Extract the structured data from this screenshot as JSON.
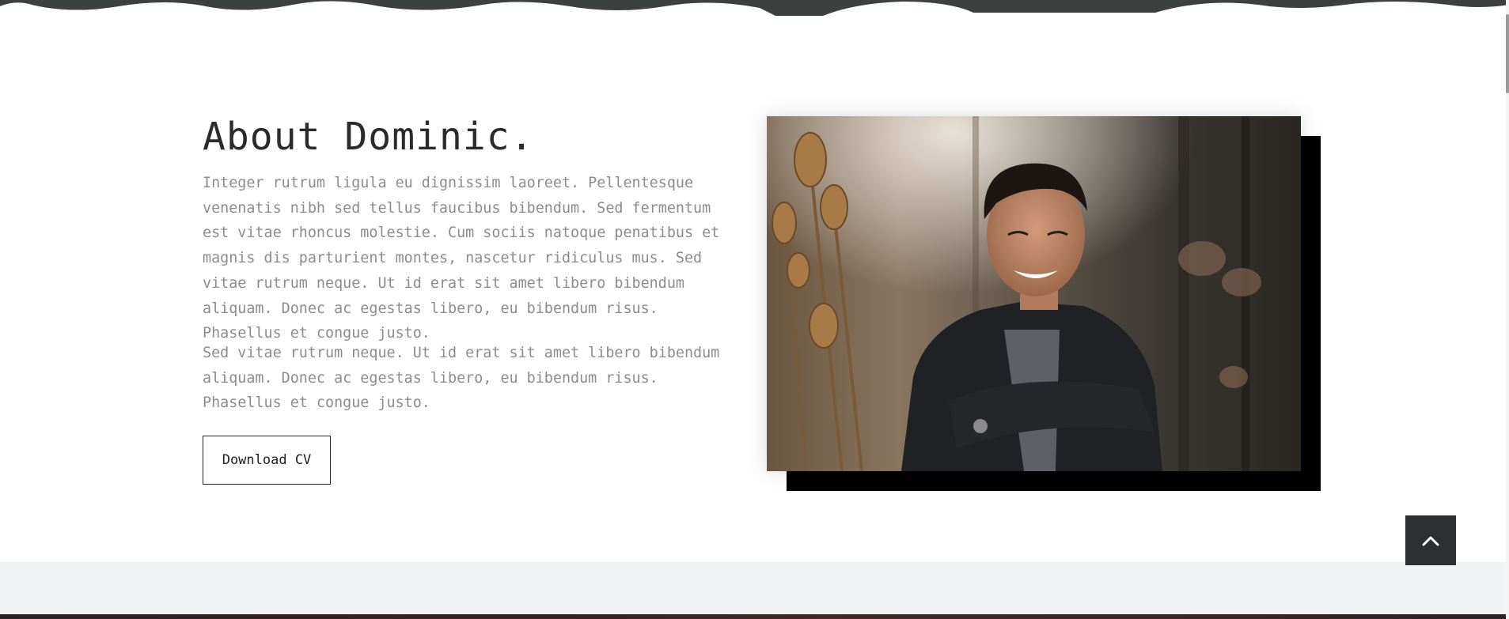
{
  "about": {
    "title": "About Dominic.",
    "paragraph_1": "Integer rutrum ligula eu dignissim laoreet. Pellentesque venenatis nibh sed tellus faucibus bibendum. Sed fermentum est vitae rhoncus molestie. Cum sociis natoque penatibus et magnis dis parturient montes, nascetur ridiculus mus. Sed vitae rutrum neque. Ut id erat sit amet libero bibendum aliquam. Donec ac egestas libero, eu bibendum risus. Phasellus et congue justo.",
    "paragraph_2": "Sed vitae rutrum neque. Ut id erat sit amet libero bibendum aliquam. Donec ac egestas libero, eu bibendum risus. Phasellus et congue justo.",
    "download_label": "Download CV"
  },
  "icons": {
    "back_to_top": "chevron-up-icon"
  },
  "colors": {
    "heading": "#2b2b2b",
    "body_text": "#8c8c8c",
    "button_border": "#222222",
    "photo_shadow": "#000000",
    "back_to_top_bg": "#2e2f31",
    "section_grey": "#f1f2f4"
  }
}
